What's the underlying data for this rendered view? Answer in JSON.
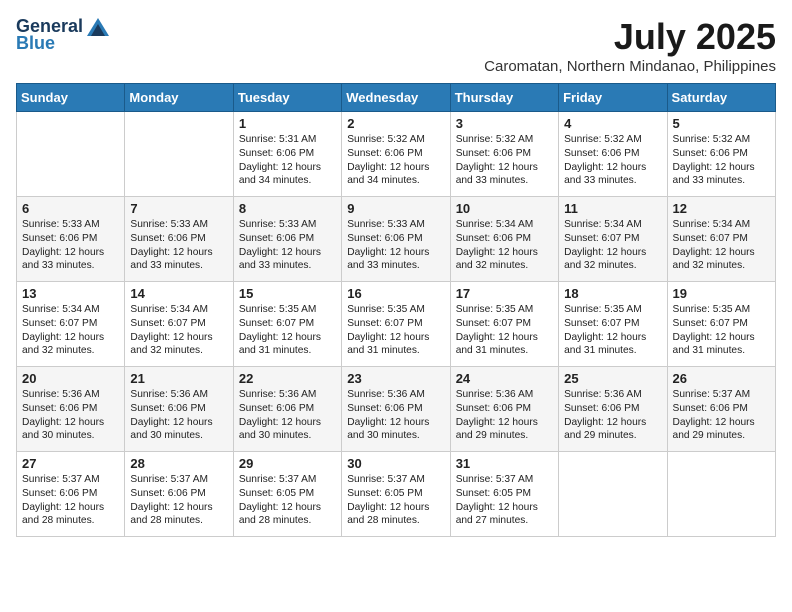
{
  "header": {
    "logo_general": "General",
    "logo_blue": "Blue",
    "month_year": "July 2025",
    "location": "Caromatan, Northern Mindanao, Philippines"
  },
  "weekdays": [
    "Sunday",
    "Monday",
    "Tuesday",
    "Wednesday",
    "Thursday",
    "Friday",
    "Saturday"
  ],
  "weeks": [
    [
      {
        "day": "",
        "content": ""
      },
      {
        "day": "",
        "content": ""
      },
      {
        "day": "1",
        "content": "Sunrise: 5:31 AM\nSunset: 6:06 PM\nDaylight: 12 hours\nand 34 minutes."
      },
      {
        "day": "2",
        "content": "Sunrise: 5:32 AM\nSunset: 6:06 PM\nDaylight: 12 hours\nand 34 minutes."
      },
      {
        "day": "3",
        "content": "Sunrise: 5:32 AM\nSunset: 6:06 PM\nDaylight: 12 hours\nand 33 minutes."
      },
      {
        "day": "4",
        "content": "Sunrise: 5:32 AM\nSunset: 6:06 PM\nDaylight: 12 hours\nand 33 minutes."
      },
      {
        "day": "5",
        "content": "Sunrise: 5:32 AM\nSunset: 6:06 PM\nDaylight: 12 hours\nand 33 minutes."
      }
    ],
    [
      {
        "day": "6",
        "content": "Sunrise: 5:33 AM\nSunset: 6:06 PM\nDaylight: 12 hours\nand 33 minutes."
      },
      {
        "day": "7",
        "content": "Sunrise: 5:33 AM\nSunset: 6:06 PM\nDaylight: 12 hours\nand 33 minutes."
      },
      {
        "day": "8",
        "content": "Sunrise: 5:33 AM\nSunset: 6:06 PM\nDaylight: 12 hours\nand 33 minutes."
      },
      {
        "day": "9",
        "content": "Sunrise: 5:33 AM\nSunset: 6:06 PM\nDaylight: 12 hours\nand 33 minutes."
      },
      {
        "day": "10",
        "content": "Sunrise: 5:34 AM\nSunset: 6:06 PM\nDaylight: 12 hours\nand 32 minutes."
      },
      {
        "day": "11",
        "content": "Sunrise: 5:34 AM\nSunset: 6:07 PM\nDaylight: 12 hours\nand 32 minutes."
      },
      {
        "day": "12",
        "content": "Sunrise: 5:34 AM\nSunset: 6:07 PM\nDaylight: 12 hours\nand 32 minutes."
      }
    ],
    [
      {
        "day": "13",
        "content": "Sunrise: 5:34 AM\nSunset: 6:07 PM\nDaylight: 12 hours\nand 32 minutes."
      },
      {
        "day": "14",
        "content": "Sunrise: 5:34 AM\nSunset: 6:07 PM\nDaylight: 12 hours\nand 32 minutes."
      },
      {
        "day": "15",
        "content": "Sunrise: 5:35 AM\nSunset: 6:07 PM\nDaylight: 12 hours\nand 31 minutes."
      },
      {
        "day": "16",
        "content": "Sunrise: 5:35 AM\nSunset: 6:07 PM\nDaylight: 12 hours\nand 31 minutes."
      },
      {
        "day": "17",
        "content": "Sunrise: 5:35 AM\nSunset: 6:07 PM\nDaylight: 12 hours\nand 31 minutes."
      },
      {
        "day": "18",
        "content": "Sunrise: 5:35 AM\nSunset: 6:07 PM\nDaylight: 12 hours\nand 31 minutes."
      },
      {
        "day": "19",
        "content": "Sunrise: 5:35 AM\nSunset: 6:07 PM\nDaylight: 12 hours\nand 31 minutes."
      }
    ],
    [
      {
        "day": "20",
        "content": "Sunrise: 5:36 AM\nSunset: 6:06 PM\nDaylight: 12 hours\nand 30 minutes."
      },
      {
        "day": "21",
        "content": "Sunrise: 5:36 AM\nSunset: 6:06 PM\nDaylight: 12 hours\nand 30 minutes."
      },
      {
        "day": "22",
        "content": "Sunrise: 5:36 AM\nSunset: 6:06 PM\nDaylight: 12 hours\nand 30 minutes."
      },
      {
        "day": "23",
        "content": "Sunrise: 5:36 AM\nSunset: 6:06 PM\nDaylight: 12 hours\nand 30 minutes."
      },
      {
        "day": "24",
        "content": "Sunrise: 5:36 AM\nSunset: 6:06 PM\nDaylight: 12 hours\nand 29 minutes."
      },
      {
        "day": "25",
        "content": "Sunrise: 5:36 AM\nSunset: 6:06 PM\nDaylight: 12 hours\nand 29 minutes."
      },
      {
        "day": "26",
        "content": "Sunrise: 5:37 AM\nSunset: 6:06 PM\nDaylight: 12 hours\nand 29 minutes."
      }
    ],
    [
      {
        "day": "27",
        "content": "Sunrise: 5:37 AM\nSunset: 6:06 PM\nDaylight: 12 hours\nand 28 minutes."
      },
      {
        "day": "28",
        "content": "Sunrise: 5:37 AM\nSunset: 6:06 PM\nDaylight: 12 hours\nand 28 minutes."
      },
      {
        "day": "29",
        "content": "Sunrise: 5:37 AM\nSunset: 6:05 PM\nDaylight: 12 hours\nand 28 minutes."
      },
      {
        "day": "30",
        "content": "Sunrise: 5:37 AM\nSunset: 6:05 PM\nDaylight: 12 hours\nand 28 minutes."
      },
      {
        "day": "31",
        "content": "Sunrise: 5:37 AM\nSunset: 6:05 PM\nDaylight: 12 hours\nand 27 minutes."
      },
      {
        "day": "",
        "content": ""
      },
      {
        "day": "",
        "content": ""
      }
    ]
  ]
}
